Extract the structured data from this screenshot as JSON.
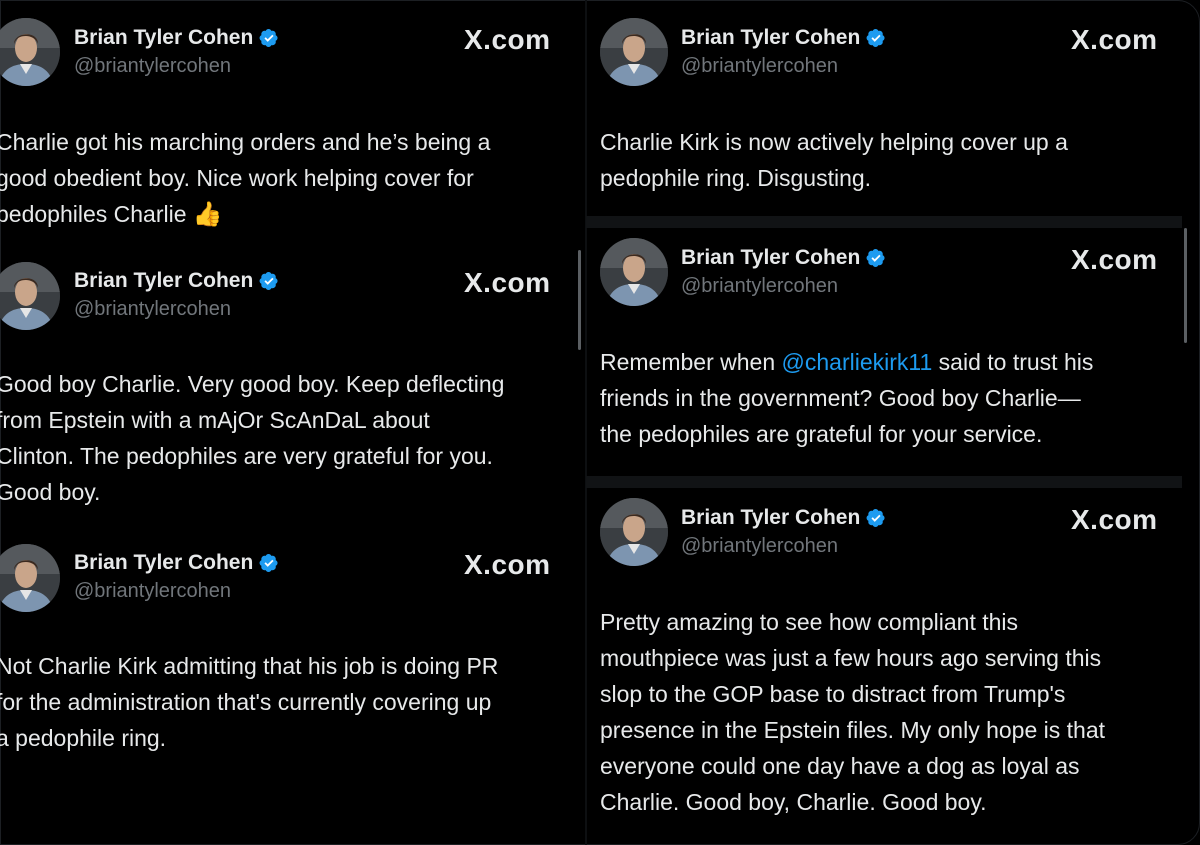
{
  "author": {
    "name": "Brian Tyler Cohen",
    "handle": "@briantylercohen",
    "verified_icon": "verified-badge-icon",
    "verified_color": "#1d9bf0"
  },
  "source_label": "X.com",
  "colors": {
    "background": "#000000",
    "text": "#e7e9ea",
    "muted": "#71767b",
    "link": "#1d9bf0"
  },
  "left_posts": [
    {
      "lines": [
        "Charlie got his marching orders and he’s being a",
        "good obedient boy. Nice work helping cover for",
        "pedophiles Charlie"
      ],
      "emoji": "👍"
    },
    {
      "lines": [
        "Good boy Charlie. Very good boy. Keep deflecting",
        "from Epstein with a mAjOr ScAnDaL about",
        "Clinton. The pedophiles are very grateful for you.",
        "Good boy."
      ]
    },
    {
      "lines": [
        "Not Charlie Kirk admitting that his job is doing PR",
        "for the administration that's currently covering up",
        "a pedophile ring."
      ]
    }
  ],
  "right_posts": [
    {
      "lines": [
        "Charlie Kirk is now actively helping cover up a",
        "pedophile ring. Disgusting."
      ]
    },
    {
      "line1_pre": "Remember when ",
      "mention": "@charliekirk11",
      "line1_post": " said to trust his",
      "lines": [
        "friends in the government? Good boy Charlie—",
        "the pedophiles are grateful for your service."
      ]
    },
    {
      "lines": [
        "Pretty amazing to see how compliant this",
        "mouthpiece was just a few hours ago serving this",
        "slop to the GOP base to distract from Trump's",
        "presence in the Epstein files. My only hope is that",
        "everyone could one day have a dog as loyal as",
        "Charlie. Good boy, Charlie. Good boy."
      ]
    }
  ]
}
